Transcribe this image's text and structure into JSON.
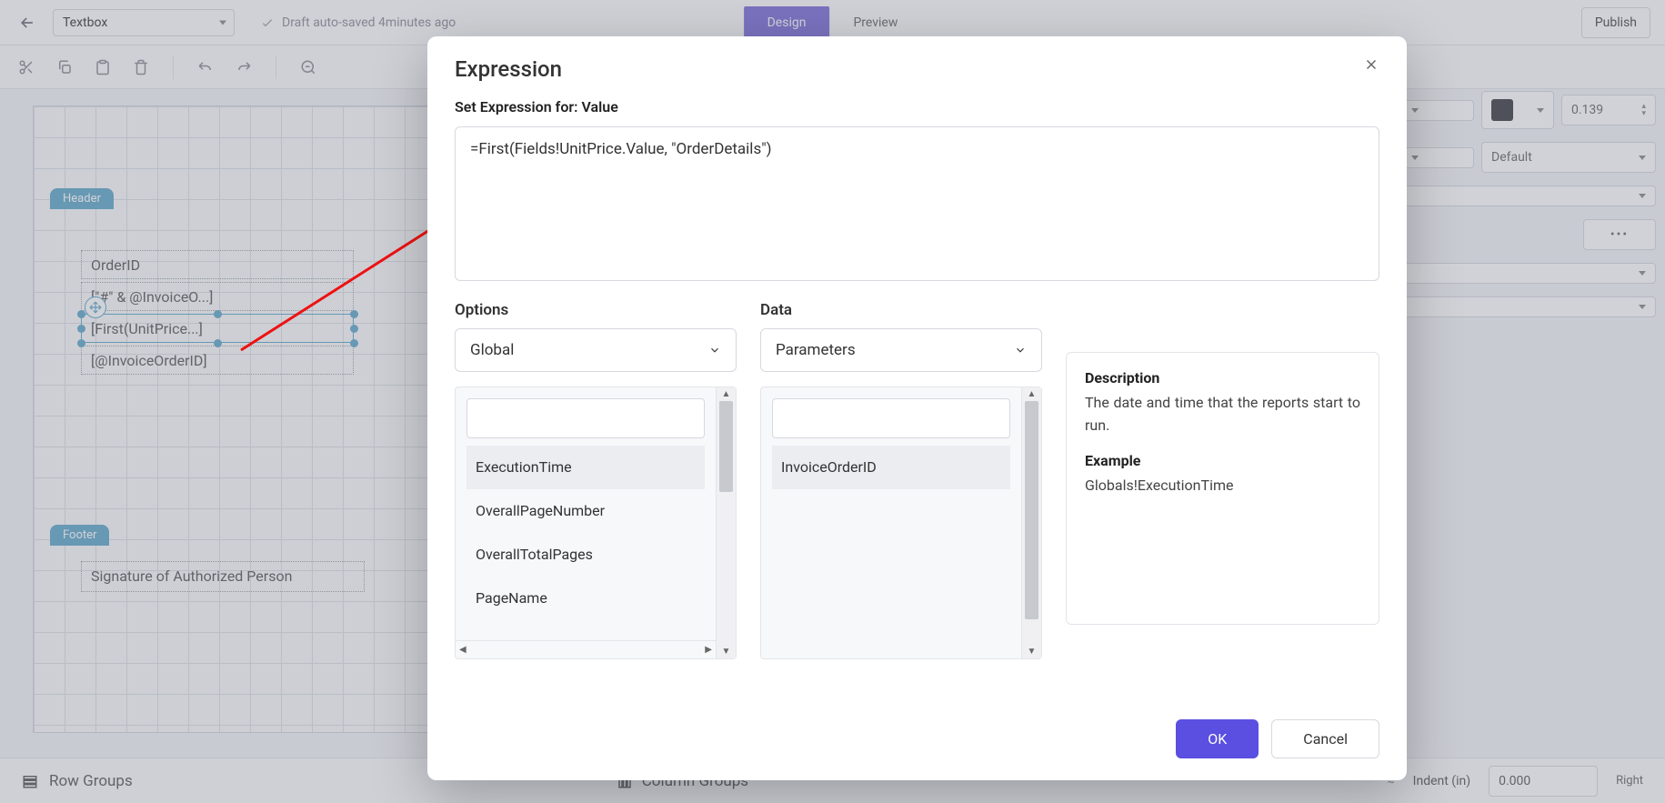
{
  "topbar": {
    "textbox_label": "Textbox",
    "autosave": "Draft auto-saved 4minutes ago",
    "publish_label": "Publish"
  },
  "tabs": {
    "design": "Design",
    "preview": "Preview"
  },
  "canvas": {
    "header_label": "Header",
    "footer_label": "Footer",
    "orderid": "OrderID",
    "invoice_expr": "[\"#\" & @InvoiceO...]",
    "first_expr": "[First(UnitPrice...]",
    "invparam": "[@InvoiceOrderID]",
    "signature": "Signature of Authorized Person"
  },
  "bottom": {
    "row_groups": "Row Groups",
    "column_groups": "Column Groups",
    "indent_label": "Indent (in)",
    "right_label": "Right",
    "indent_value": "0.000"
  },
  "props": {
    "opacity": "0.139",
    "default": "Default"
  },
  "modal": {
    "title": "Expression",
    "set_label": "Set Expression for: Value",
    "expression": "=First(Fields!UnitPrice.Value, \"OrderDetails\")",
    "options_label": "Options",
    "options_selected": "Global",
    "options_items": [
      "ExecutionTime",
      "OverallPageNumber",
      "OverallTotalPages",
      "PageName"
    ],
    "data_label": "Data",
    "data_selected": "Parameters",
    "data_items": [
      "InvoiceOrderID"
    ],
    "desc_h": "Description",
    "desc_text": "The date and time that the reports start to run.",
    "example_h": "Example",
    "example_text": "Globals!ExecutionTime",
    "ok": "OK",
    "cancel": "Cancel"
  }
}
